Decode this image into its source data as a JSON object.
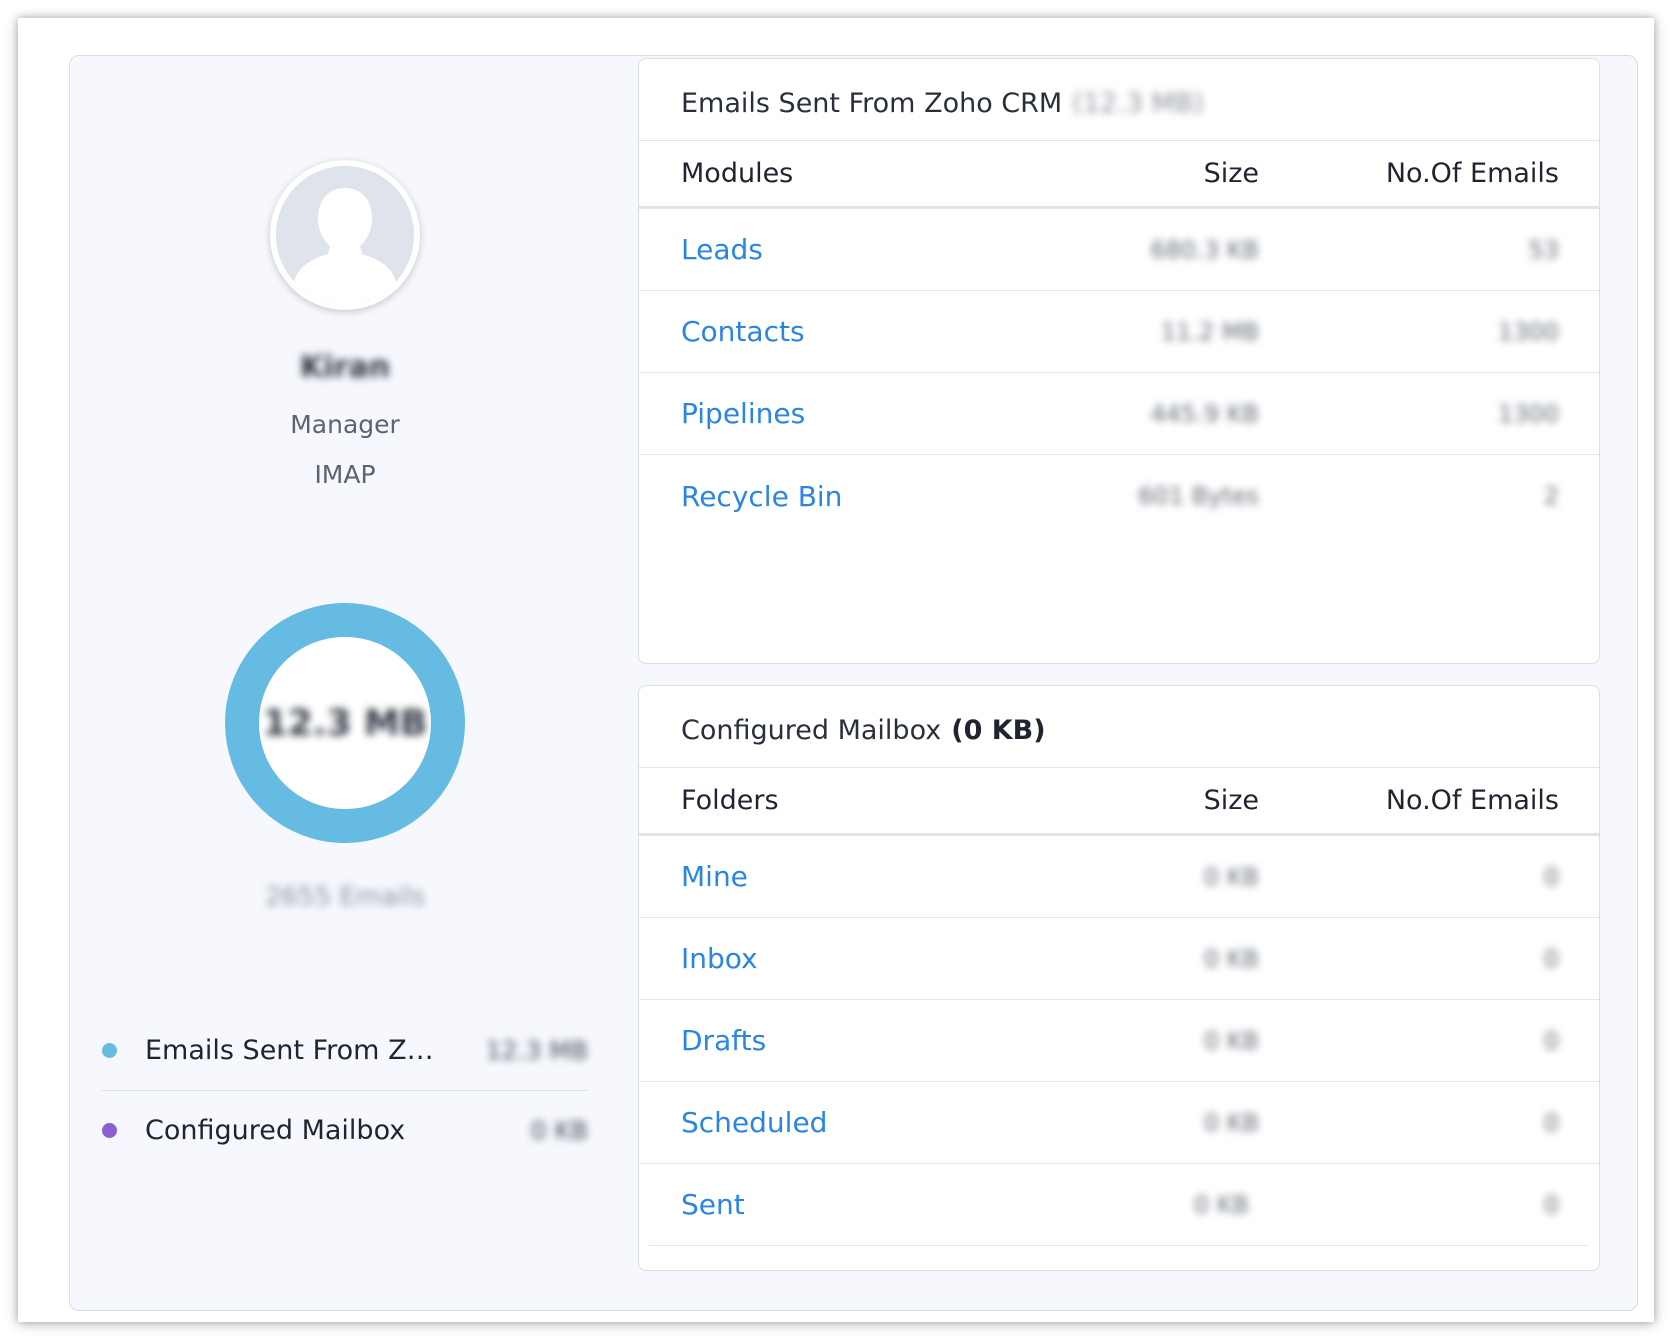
{
  "user": {
    "name": "Kiran",
    "role": "Manager",
    "protocol": "IMAP"
  },
  "summary": {
    "total_size": "12.3 MB",
    "total_emails": "2655 Emails",
    "ring_color": "#66bbe2"
  },
  "legend": [
    {
      "label": "Emails Sent From Zo...",
      "value": "12.3 MB",
      "color": "#66bbe2"
    },
    {
      "label": "Configured Mailbox",
      "value": "0 KB",
      "color": "#8a5fd6"
    }
  ],
  "crm_card": {
    "title": "Emails Sent From Zoho CRM",
    "size": "(12.3 MB)",
    "headers": {
      "col1": "Modules",
      "col2": "Size",
      "col3": "No.Of Emails"
    },
    "rows": [
      {
        "name": "Leads",
        "size": "680.3 KB",
        "count": "53"
      },
      {
        "name": "Contacts",
        "size": "11.2 MB",
        "count": "1300"
      },
      {
        "name": "Pipelines",
        "size": "445.9 KB",
        "count": "1300"
      },
      {
        "name": "Recycle Bin",
        "size": "601 Bytes",
        "count": "2"
      }
    ]
  },
  "mailbox_card": {
    "title": "Configured Mailbox",
    "size": "(0 KB)",
    "headers": {
      "col1": "Folders",
      "col2": "Size",
      "col3": "No.Of Emails"
    },
    "rows": [
      {
        "name": "Mine",
        "size": "0 KB",
        "count": "0"
      },
      {
        "name": "Inbox",
        "size": "0 KB",
        "count": "0"
      },
      {
        "name": "Drafts",
        "size": "0 KB",
        "count": "0"
      },
      {
        "name": "Scheduled",
        "size": "0 KB",
        "count": "0"
      },
      {
        "name": "Sent",
        "size": "0 KB",
        "count": "0"
      }
    ]
  },
  "colors": {
    "link": "#2b86e0",
    "panel_bg": "#f6f8fd"
  }
}
